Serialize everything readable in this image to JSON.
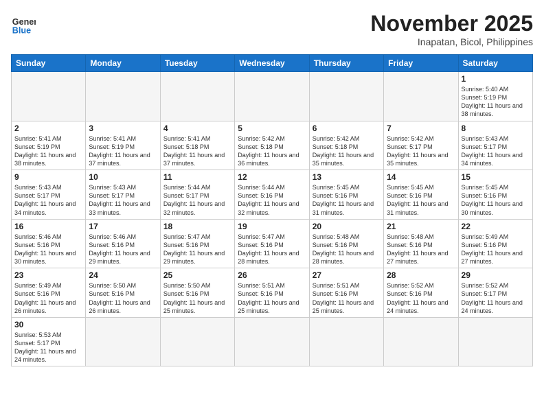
{
  "header": {
    "logo_general": "General",
    "logo_blue": "Blue",
    "title": "November 2025",
    "subtitle": "Inapatan, Bicol, Philippines"
  },
  "weekdays": [
    "Sunday",
    "Monday",
    "Tuesday",
    "Wednesday",
    "Thursday",
    "Friday",
    "Saturday"
  ],
  "days": [
    {
      "num": "",
      "sunrise": "",
      "sunset": "",
      "daylight": ""
    },
    {
      "num": "",
      "sunrise": "",
      "sunset": "",
      "daylight": ""
    },
    {
      "num": "",
      "sunrise": "",
      "sunset": "",
      "daylight": ""
    },
    {
      "num": "",
      "sunrise": "",
      "sunset": "",
      "daylight": ""
    },
    {
      "num": "",
      "sunrise": "",
      "sunset": "",
      "daylight": ""
    },
    {
      "num": "",
      "sunrise": "",
      "sunset": "",
      "daylight": ""
    },
    {
      "num": "1",
      "sunrise": "Sunrise: 5:40 AM",
      "sunset": "Sunset: 5:19 PM",
      "daylight": "Daylight: 11 hours and 38 minutes."
    },
    {
      "num": "2",
      "sunrise": "Sunrise: 5:41 AM",
      "sunset": "Sunset: 5:19 PM",
      "daylight": "Daylight: 11 hours and 38 minutes."
    },
    {
      "num": "3",
      "sunrise": "Sunrise: 5:41 AM",
      "sunset": "Sunset: 5:19 PM",
      "daylight": "Daylight: 11 hours and 37 minutes."
    },
    {
      "num": "4",
      "sunrise": "Sunrise: 5:41 AM",
      "sunset": "Sunset: 5:18 PM",
      "daylight": "Daylight: 11 hours and 37 minutes."
    },
    {
      "num": "5",
      "sunrise": "Sunrise: 5:42 AM",
      "sunset": "Sunset: 5:18 PM",
      "daylight": "Daylight: 11 hours and 36 minutes."
    },
    {
      "num": "6",
      "sunrise": "Sunrise: 5:42 AM",
      "sunset": "Sunset: 5:18 PM",
      "daylight": "Daylight: 11 hours and 35 minutes."
    },
    {
      "num": "7",
      "sunrise": "Sunrise: 5:42 AM",
      "sunset": "Sunset: 5:17 PM",
      "daylight": "Daylight: 11 hours and 35 minutes."
    },
    {
      "num": "8",
      "sunrise": "Sunrise: 5:43 AM",
      "sunset": "Sunset: 5:17 PM",
      "daylight": "Daylight: 11 hours and 34 minutes."
    },
    {
      "num": "9",
      "sunrise": "Sunrise: 5:43 AM",
      "sunset": "Sunset: 5:17 PM",
      "daylight": "Daylight: 11 hours and 34 minutes."
    },
    {
      "num": "10",
      "sunrise": "Sunrise: 5:43 AM",
      "sunset": "Sunset: 5:17 PM",
      "daylight": "Daylight: 11 hours and 33 minutes."
    },
    {
      "num": "11",
      "sunrise": "Sunrise: 5:44 AM",
      "sunset": "Sunset: 5:17 PM",
      "daylight": "Daylight: 11 hours and 32 minutes."
    },
    {
      "num": "12",
      "sunrise": "Sunrise: 5:44 AM",
      "sunset": "Sunset: 5:16 PM",
      "daylight": "Daylight: 11 hours and 32 minutes."
    },
    {
      "num": "13",
      "sunrise": "Sunrise: 5:45 AM",
      "sunset": "Sunset: 5:16 PM",
      "daylight": "Daylight: 11 hours and 31 minutes."
    },
    {
      "num": "14",
      "sunrise": "Sunrise: 5:45 AM",
      "sunset": "Sunset: 5:16 PM",
      "daylight": "Daylight: 11 hours and 31 minutes."
    },
    {
      "num": "15",
      "sunrise": "Sunrise: 5:45 AM",
      "sunset": "Sunset: 5:16 PM",
      "daylight": "Daylight: 11 hours and 30 minutes."
    },
    {
      "num": "16",
      "sunrise": "Sunrise: 5:46 AM",
      "sunset": "Sunset: 5:16 PM",
      "daylight": "Daylight: 11 hours and 30 minutes."
    },
    {
      "num": "17",
      "sunrise": "Sunrise: 5:46 AM",
      "sunset": "Sunset: 5:16 PM",
      "daylight": "Daylight: 11 hours and 29 minutes."
    },
    {
      "num": "18",
      "sunrise": "Sunrise: 5:47 AM",
      "sunset": "Sunset: 5:16 PM",
      "daylight": "Daylight: 11 hours and 29 minutes."
    },
    {
      "num": "19",
      "sunrise": "Sunrise: 5:47 AM",
      "sunset": "Sunset: 5:16 PM",
      "daylight": "Daylight: 11 hours and 28 minutes."
    },
    {
      "num": "20",
      "sunrise": "Sunrise: 5:48 AM",
      "sunset": "Sunset: 5:16 PM",
      "daylight": "Daylight: 11 hours and 28 minutes."
    },
    {
      "num": "21",
      "sunrise": "Sunrise: 5:48 AM",
      "sunset": "Sunset: 5:16 PM",
      "daylight": "Daylight: 11 hours and 27 minutes."
    },
    {
      "num": "22",
      "sunrise": "Sunrise: 5:49 AM",
      "sunset": "Sunset: 5:16 PM",
      "daylight": "Daylight: 11 hours and 27 minutes."
    },
    {
      "num": "23",
      "sunrise": "Sunrise: 5:49 AM",
      "sunset": "Sunset: 5:16 PM",
      "daylight": "Daylight: 11 hours and 26 minutes."
    },
    {
      "num": "24",
      "sunrise": "Sunrise: 5:50 AM",
      "sunset": "Sunset: 5:16 PM",
      "daylight": "Daylight: 11 hours and 26 minutes."
    },
    {
      "num": "25",
      "sunrise": "Sunrise: 5:50 AM",
      "sunset": "Sunset: 5:16 PM",
      "daylight": "Daylight: 11 hours and 25 minutes."
    },
    {
      "num": "26",
      "sunrise": "Sunrise: 5:51 AM",
      "sunset": "Sunset: 5:16 PM",
      "daylight": "Daylight: 11 hours and 25 minutes."
    },
    {
      "num": "27",
      "sunrise": "Sunrise: 5:51 AM",
      "sunset": "Sunset: 5:16 PM",
      "daylight": "Daylight: 11 hours and 25 minutes."
    },
    {
      "num": "28",
      "sunrise": "Sunrise: 5:52 AM",
      "sunset": "Sunset: 5:16 PM",
      "daylight": "Daylight: 11 hours and 24 minutes."
    },
    {
      "num": "29",
      "sunrise": "Sunrise: 5:52 AM",
      "sunset": "Sunset: 5:17 PM",
      "daylight": "Daylight: 11 hours and 24 minutes."
    },
    {
      "num": "30",
      "sunrise": "Sunrise: 5:53 AM",
      "sunset": "Sunset: 5:17 PM",
      "daylight": "Daylight: 11 hours and 24 minutes."
    }
  ]
}
